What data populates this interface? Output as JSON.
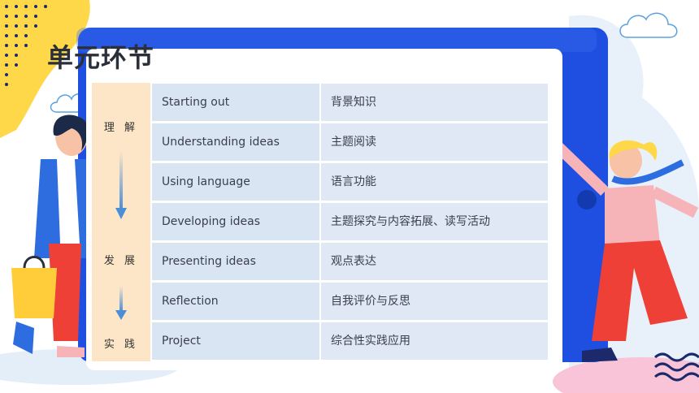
{
  "title": "单元环节",
  "side_labels": [
    "理 解",
    "发 展",
    "实 践"
  ],
  "rows": [
    {
      "stage": "Starting out",
      "desc": "背景知识"
    },
    {
      "stage": "Understanding ideas",
      "desc": "主题阅读"
    },
    {
      "stage": "Using language",
      "desc": "语言功能"
    },
    {
      "stage": "Developing ideas",
      "desc": "主题探究与内容拓展、读写活动"
    },
    {
      "stage": "Presenting ideas",
      "desc": "观点表达"
    },
    {
      "stage": "Reflection",
      "desc": "自我评价与反思"
    },
    {
      "stage": "Project",
      "desc": "综合性实践应用"
    }
  ],
  "colors": {
    "frame": "#1f4fe0",
    "side": "#fde6c8",
    "cell": "#d9e5f3",
    "accent_yellow": "#ffd84a",
    "shirt_pink": "#f6b3b8",
    "pants_red": "#ee4037"
  }
}
